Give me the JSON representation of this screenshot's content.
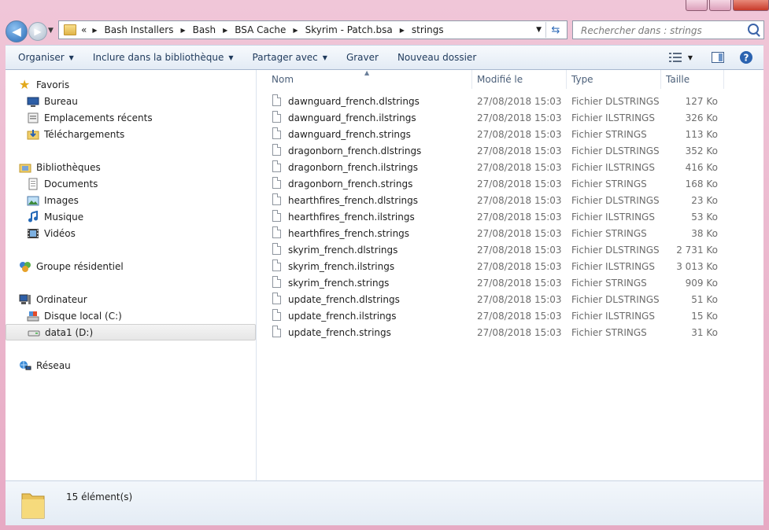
{
  "address": {
    "overflow_glyph": "«",
    "crumbs": [
      "Bash Installers",
      "Bash",
      "BSA Cache",
      "Skyrim - Patch.bsa",
      "strings"
    ]
  },
  "search": {
    "placeholder": "Rechercher dans : strings"
  },
  "toolbar": {
    "organiser": "Organiser",
    "inclure": "Inclure dans la bibliothèque",
    "partager": "Partager avec",
    "graver": "Graver",
    "nouveau": "Nouveau dossier"
  },
  "sidebar": {
    "favoris": "Favoris",
    "bureau": "Bureau",
    "recents": "Emplacements récents",
    "telechargements": "Téléchargements",
    "bibliotheques": "Bibliothèques",
    "documents": "Documents",
    "images": "Images",
    "musique": "Musique",
    "videos": "Vidéos",
    "groupe": "Groupe résidentiel",
    "ordinateur": "Ordinateur",
    "disque_c": "Disque local (C:)",
    "data1": "data1 (D:)",
    "reseau": "Réseau"
  },
  "columns": {
    "nom": "Nom",
    "modifie": "Modifié le",
    "type": "Type",
    "taille": "Taille"
  },
  "files": [
    {
      "name": "dawnguard_french.dlstrings",
      "date": "27/08/2018 15:03",
      "type": "Fichier DLSTRINGS",
      "size": "127 Ko"
    },
    {
      "name": "dawnguard_french.ilstrings",
      "date": "27/08/2018 15:03",
      "type": "Fichier ILSTRINGS",
      "size": "326 Ko"
    },
    {
      "name": "dawnguard_french.strings",
      "date": "27/08/2018 15:03",
      "type": "Fichier STRINGS",
      "size": "113 Ko"
    },
    {
      "name": "dragonborn_french.dlstrings",
      "date": "27/08/2018 15:03",
      "type": "Fichier DLSTRINGS",
      "size": "352 Ko"
    },
    {
      "name": "dragonborn_french.ilstrings",
      "date": "27/08/2018 15:03",
      "type": "Fichier ILSTRINGS",
      "size": "416 Ko"
    },
    {
      "name": "dragonborn_french.strings",
      "date": "27/08/2018 15:03",
      "type": "Fichier STRINGS",
      "size": "168 Ko"
    },
    {
      "name": "hearthfires_french.dlstrings",
      "date": "27/08/2018 15:03",
      "type": "Fichier DLSTRINGS",
      "size": "23 Ko"
    },
    {
      "name": "hearthfires_french.ilstrings",
      "date": "27/08/2018 15:03",
      "type": "Fichier ILSTRINGS",
      "size": "53 Ko"
    },
    {
      "name": "hearthfires_french.strings",
      "date": "27/08/2018 15:03",
      "type": "Fichier STRINGS",
      "size": "38 Ko"
    },
    {
      "name": "skyrim_french.dlstrings",
      "date": "27/08/2018 15:03",
      "type": "Fichier DLSTRINGS",
      "size": "2 731 Ko"
    },
    {
      "name": "skyrim_french.ilstrings",
      "date": "27/08/2018 15:03",
      "type": "Fichier ILSTRINGS",
      "size": "3 013 Ko"
    },
    {
      "name": "skyrim_french.strings",
      "date": "27/08/2018 15:03",
      "type": "Fichier STRINGS",
      "size": "909 Ko"
    },
    {
      "name": "update_french.dlstrings",
      "date": "27/08/2018 15:03",
      "type": "Fichier DLSTRINGS",
      "size": "51 Ko"
    },
    {
      "name": "update_french.ilstrings",
      "date": "27/08/2018 15:03",
      "type": "Fichier ILSTRINGS",
      "size": "15 Ko"
    },
    {
      "name": "update_french.strings",
      "date": "27/08/2018 15:03",
      "type": "Fichier STRINGS",
      "size": "31 Ko"
    }
  ],
  "status": {
    "count": "15 élément(s)"
  }
}
